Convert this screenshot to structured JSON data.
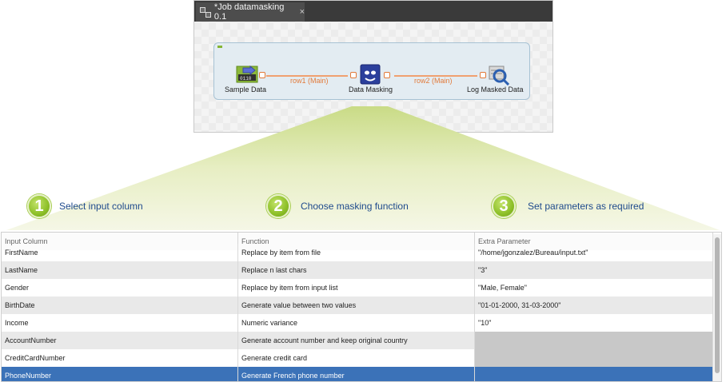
{
  "job_tab": {
    "title": "*Job datamasking 0.1",
    "close": "×"
  },
  "components": [
    {
      "label": "Sample Data",
      "icon": "row-generator-icon"
    },
    {
      "label": "Data Masking",
      "icon": "mask-icon"
    },
    {
      "label": "Log Masked Data",
      "icon": "log-row-icon"
    }
  ],
  "flows": [
    {
      "label": "row1 (Main)"
    },
    {
      "label": "row2 (Main)"
    }
  ],
  "steps": [
    {
      "number": "1",
      "text": "Select input column"
    },
    {
      "number": "2",
      "text": "Choose masking function"
    },
    {
      "number": "3",
      "text": "Set parameters as required"
    }
  ],
  "table": {
    "headers": [
      "Input Column",
      "Function",
      "Extra Parameter"
    ],
    "rows": [
      {
        "col": "FirstName",
        "fn": "Replace by item from file",
        "param": "\"/home/jgonzalez/Bureau/input.txt\""
      },
      {
        "col": "LastName",
        "fn": "Replace n last chars",
        "param": "\"3\""
      },
      {
        "col": "Gender",
        "fn": "Replace by item from input list",
        "param": "\"Male, Female\""
      },
      {
        "col": "BirthDate",
        "fn": "Generate value between two values",
        "param": "\"01-01-2000, 31-03-2000\""
      },
      {
        "col": "Income",
        "fn": "Numeric variance",
        "param": "\"10\""
      },
      {
        "col": "AccountNumber",
        "fn": "Generate account number and keep original country",
        "param": ""
      },
      {
        "col": "CreditCardNumber",
        "fn": "Generate credit card",
        "param": ""
      },
      {
        "col": "PhoneNumber",
        "fn": "Generate French phone number",
        "param": ""
      }
    ]
  },
  "colors": {
    "accent_green": "#8dc028",
    "step_text": "#1e4a8c",
    "selected_row": "#3b72b8",
    "flow_orange": "#e27a3a"
  }
}
